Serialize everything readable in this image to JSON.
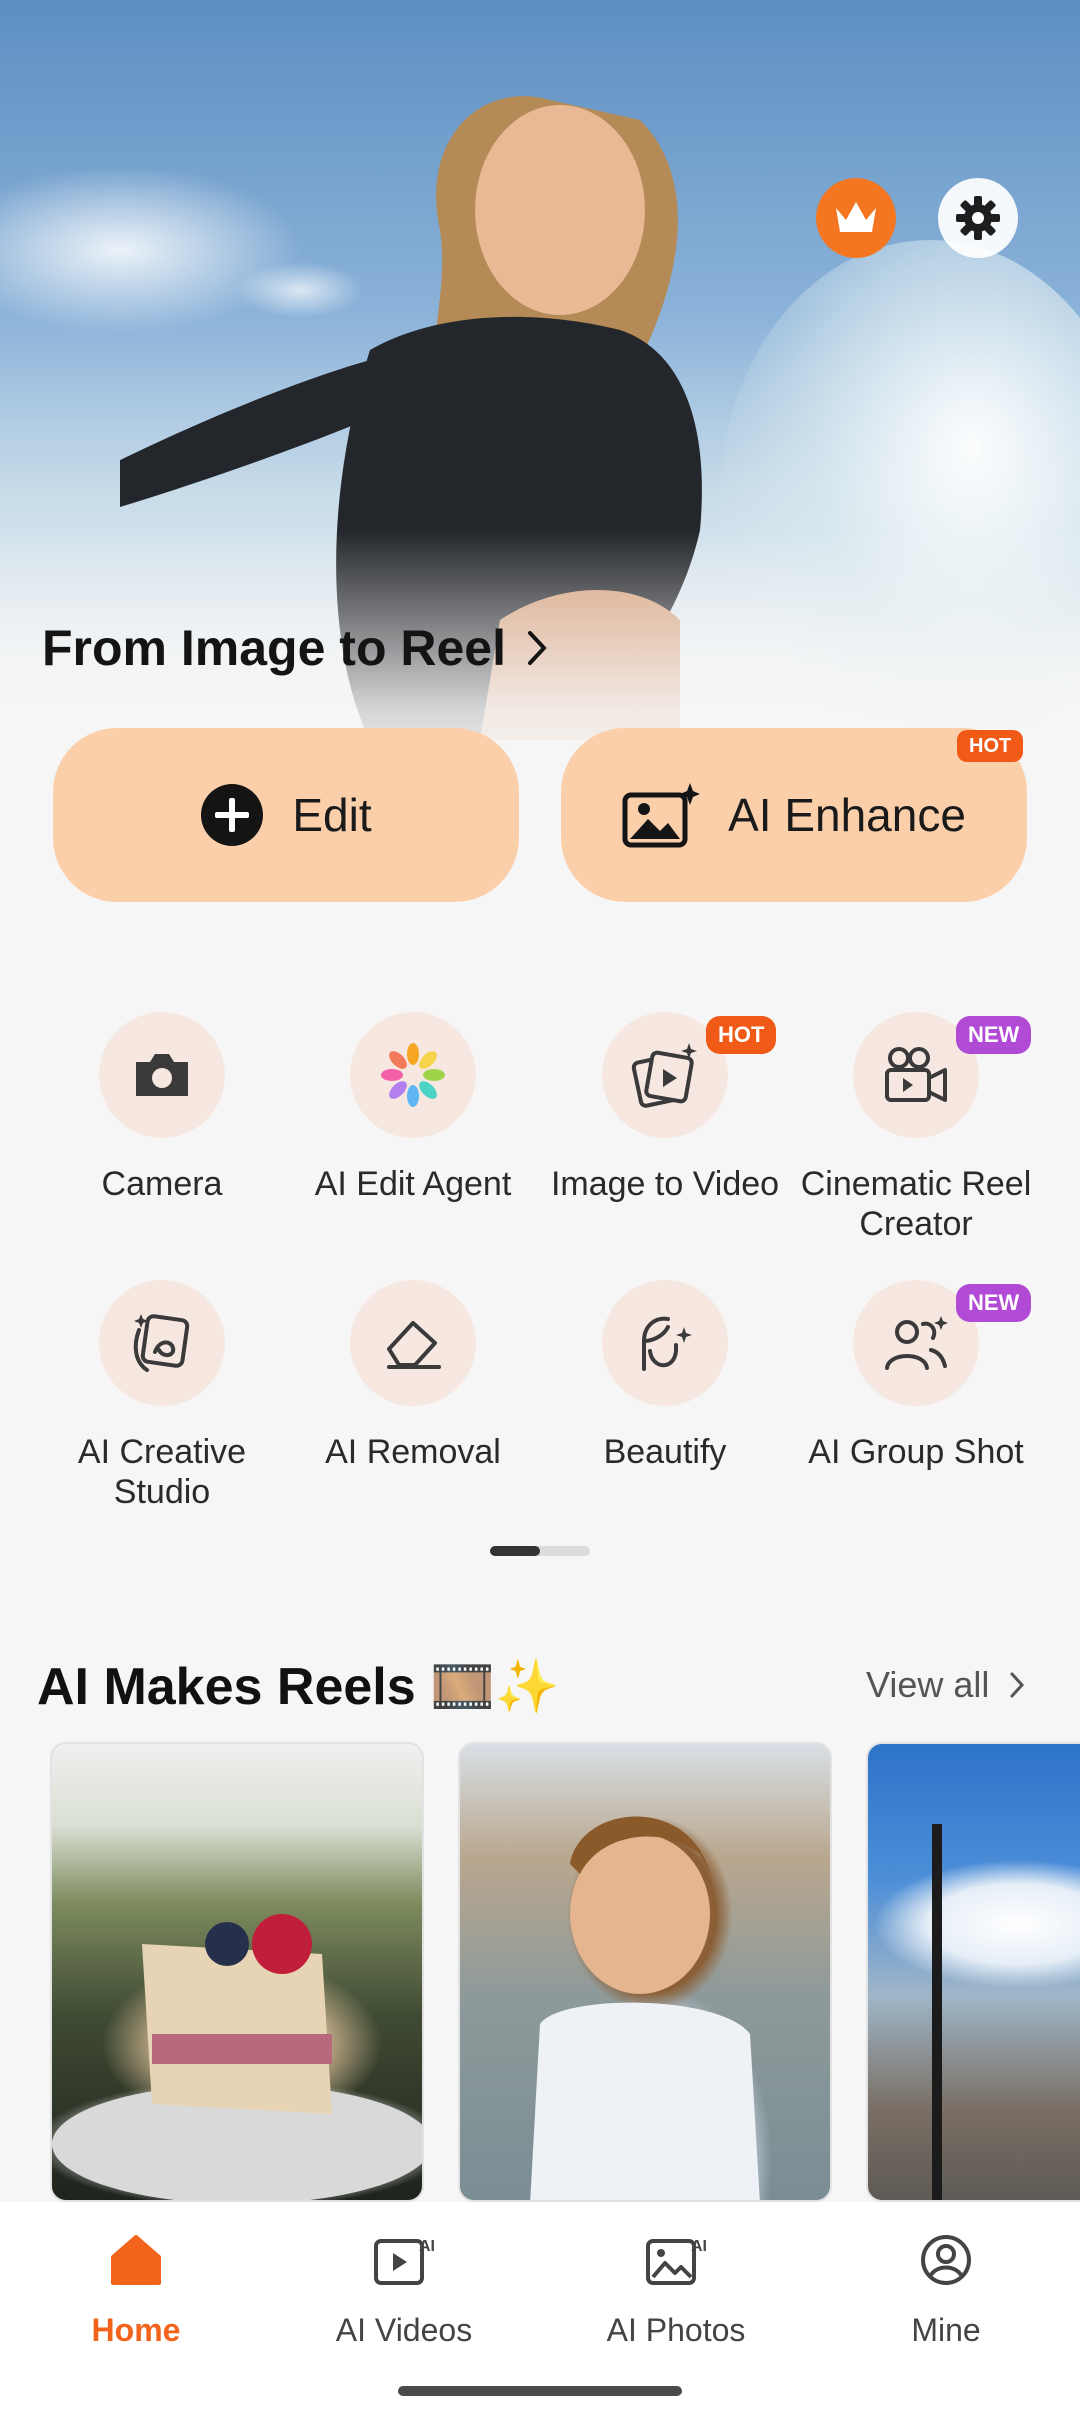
{
  "hero": {
    "title": "From Image to Reel",
    "crown_icon": "crown-icon",
    "settings_icon": "gear-icon"
  },
  "actions": {
    "edit_label": "Edit",
    "enhance_label": "AI Enhance",
    "enhance_badge": "HOT"
  },
  "tools": [
    {
      "label": "Camera",
      "icon": "camera-icon"
    },
    {
      "label": "AI Edit Agent",
      "icon": "color-wheel-icon"
    },
    {
      "label": "Image to Video",
      "icon": "image-to-video-icon",
      "badge": "HOT"
    },
    {
      "label": "Cinematic Reel Creator",
      "icon": "movie-camera-icon",
      "badge": "NEW"
    },
    {
      "label": "AI Creative Studio",
      "icon": "creative-studio-icon"
    },
    {
      "label": "AI Removal",
      "icon": "eraser-icon"
    },
    {
      "label": "Beautify",
      "icon": "face-sparkle-icon"
    },
    {
      "label": "AI Group Shot",
      "icon": "group-icon",
      "badge": "NEW"
    }
  ],
  "pager": {
    "pages": 2,
    "current": 1
  },
  "reels_section": {
    "title": "AI Makes Reels 🎞️✨",
    "view_all": "View all"
  },
  "nav": [
    {
      "label": "Home",
      "icon": "home-icon",
      "active": true
    },
    {
      "label": "AI Videos",
      "icon": "ai-videos-icon"
    },
    {
      "label": "AI Photos",
      "icon": "ai-photos-icon"
    },
    {
      "label": "Mine",
      "icon": "profile-icon"
    }
  ],
  "colors": {
    "accent": "#f2641c",
    "button_bg": "#fbcfaa",
    "hot": "#f15a16",
    "new": "#b14ad4"
  }
}
